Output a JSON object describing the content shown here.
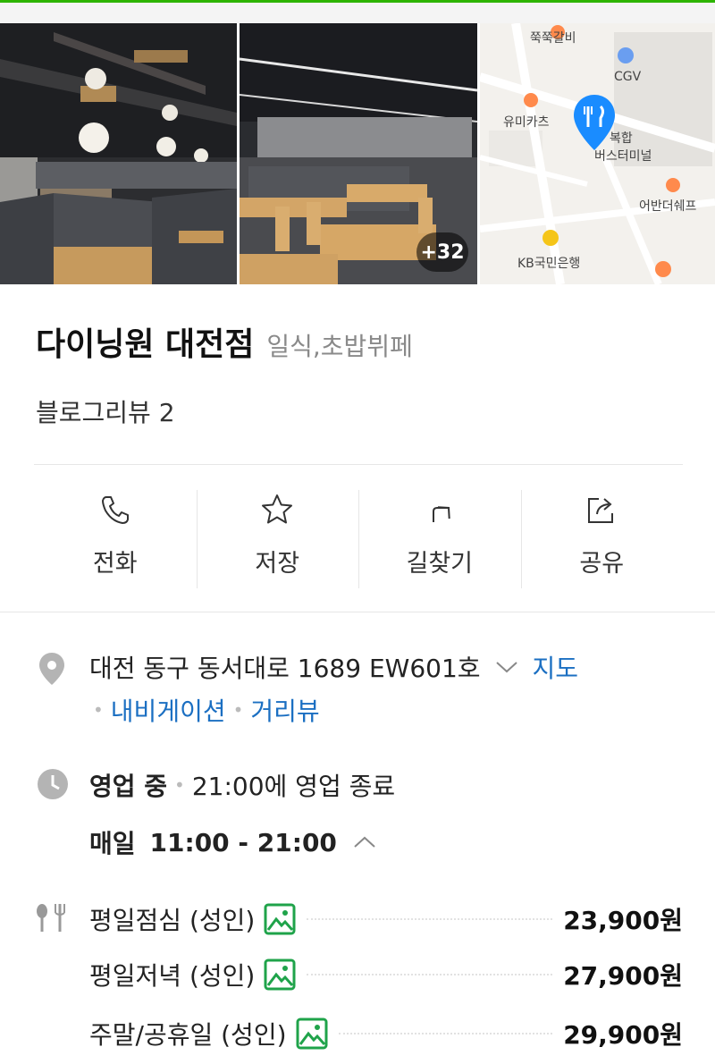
{
  "gallery": {
    "more_count": "+32",
    "map_labels": {
      "l1": "쭉쭉갈비",
      "l2": "CGV",
      "l3": "유미카츠",
      "l4": "복합",
      "l5": "버스터미널",
      "l6": "어반더쉐프",
      "l7": "KB국민은행"
    }
  },
  "place": {
    "name": "다이닝원 대전점",
    "category": "일식,초밥뷔페",
    "blog_review": "블로그리뷰 2"
  },
  "actions": [
    {
      "label": "전화",
      "icon": "phone-icon"
    },
    {
      "label": "저장",
      "icon": "star-icon"
    },
    {
      "label": "길찾기",
      "icon": "directions-icon"
    },
    {
      "label": "공유",
      "icon": "share-icon"
    }
  ],
  "address": {
    "text": "대전 동구 동서대로 1689 EW601호",
    "map_link": "지도",
    "navigation": "내비게이션",
    "street_view": "거리뷰"
  },
  "hours": {
    "status": "영업 중",
    "close_text": "21:00에 영업 종료",
    "daily_label": "매일",
    "daily_time": "11:00 - 21:00"
  },
  "menu": [
    {
      "name": "평일점심 (성인)",
      "price": "23,900원"
    },
    {
      "name": "평일저녁 (성인)",
      "price": "27,900원"
    },
    {
      "name": "주말/공휴일 (성인)",
      "price": "29,900원"
    }
  ],
  "colors": {
    "link_blue": "#1b6fc2",
    "pin_blue": "#1a8cff",
    "image_icon_green": "#1fa34a",
    "brand_green": "#2db400"
  }
}
